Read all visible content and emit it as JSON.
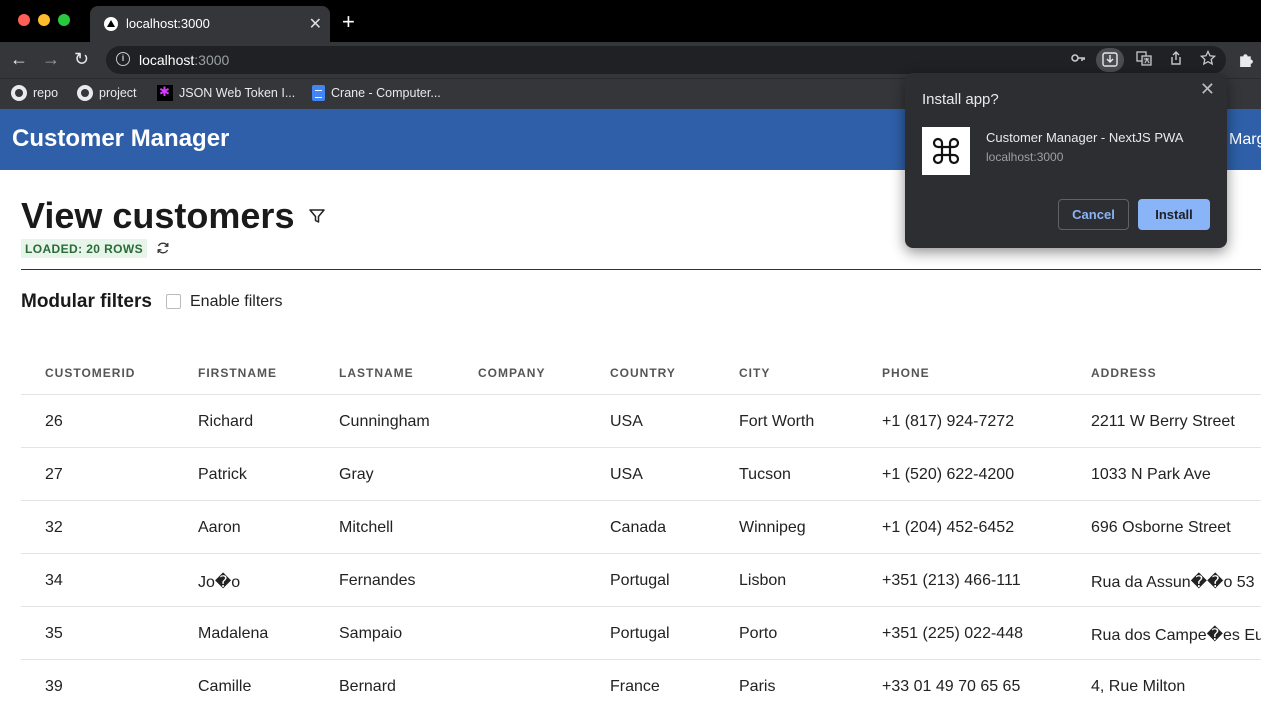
{
  "browser": {
    "tab_title": "localhost:3000",
    "new_tab_glyph": "+",
    "tab_close_glyph": "✕",
    "url_host": "localhost",
    "url_port": ":3000",
    "back_glyph": "←",
    "forward_glyph": "→",
    "reload_glyph": "↻",
    "bookmarks": [
      {
        "label": "repo",
        "icon": "github-icon"
      },
      {
        "label": "project",
        "icon": "github-icon"
      },
      {
        "label": "JSON Web Token I...",
        "icon": "jwt-icon"
      },
      {
        "label": "Crane - Computer...",
        "icon": "google-docs-icon"
      }
    ]
  },
  "app": {
    "title": "Customer Manager",
    "user_partial": "Marg",
    "header_color": "#2e5fa8"
  },
  "page": {
    "title": "View customers",
    "status_badge": "LOADED: 20 ROWS",
    "section_title": "Modular filters",
    "enable_filters_label": "Enable filters",
    "enable_filters_checked": false
  },
  "table": {
    "columns": [
      "CUSTOMERID",
      "FIRSTNAME",
      "LASTNAME",
      "COMPANY",
      "COUNTRY",
      "CITY",
      "PHONE",
      "ADDRESS"
    ],
    "rows": [
      [
        "26",
        "Richard",
        "Cunningham",
        "",
        "USA",
        "Fort Worth",
        "+1 (817) 924-7272",
        "2211 W Berry Street"
      ],
      [
        "27",
        "Patrick",
        "Gray",
        "",
        "USA",
        "Tucson",
        "+1 (520) 622-4200",
        "1033 N Park Ave"
      ],
      [
        "32",
        "Aaron",
        "Mitchell",
        "",
        "Canada",
        "Winnipeg",
        "+1 (204) 452-6452",
        "696 Osborne Street"
      ],
      [
        "34",
        "Jo�o",
        "Fernandes",
        "",
        "Portugal",
        "Lisbon",
        "+351 (213) 466-111",
        "Rua da Assun��o 53"
      ],
      [
        "35",
        "Madalena",
        "Sampaio",
        "",
        "Portugal",
        "Porto",
        "+351 (225) 022-448",
        "Rua dos Campe�es Eu"
      ],
      [
        "39",
        "Camille",
        "Bernard",
        "",
        "France",
        "Paris",
        "+33 01 49 70 65 65",
        "4, Rue Milton"
      ]
    ]
  },
  "install_dialog": {
    "title": "Install app?",
    "app_name": "Customer Manager - NextJS PWA",
    "origin": "localhost:3000",
    "cancel_label": "Cancel",
    "install_label": "Install",
    "close_glyph": "✕",
    "accent": "#8ab4f8"
  }
}
